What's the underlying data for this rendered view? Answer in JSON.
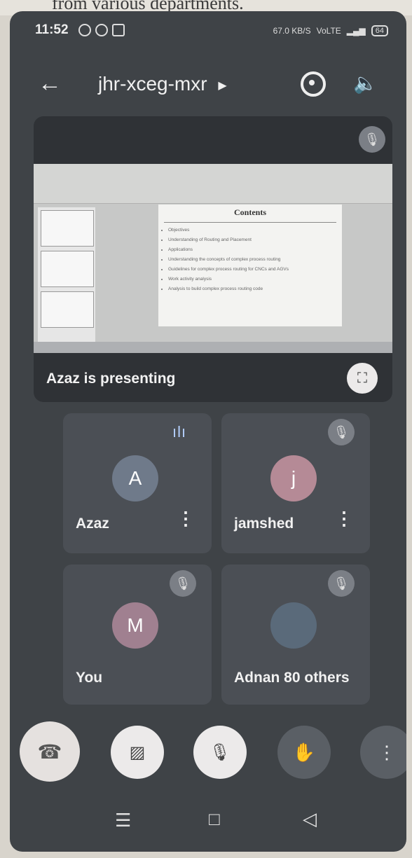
{
  "background_text": "from various departments.",
  "status_bar": {
    "time": "11:52",
    "speed": "67.0 KB/S",
    "network": "VoLTE",
    "battery": "64"
  },
  "header": {
    "meeting_code": "jhr-xceg-mxr",
    "back_icon": "arrow-left-icon",
    "switch_camera_icon": "switch-camera-icon",
    "speaker_icon": "speaker-icon"
  },
  "presentation": {
    "label": "Azaz is presenting",
    "slide_title": "Contents",
    "slide_bullets": [
      "Objectives",
      "Understanding of Routing and Placement",
      "Applications",
      "Understanding the concepts of complex process routing",
      "Guidelines for complex process routing for CNCs and AGVs",
      "Work activity analysis",
      "Analysis to build complex process routing code"
    ]
  },
  "participants": [
    {
      "name": "Azaz",
      "initial": "A",
      "color": "#6f7a8a",
      "muted": false,
      "speaking": true
    },
    {
      "name": "jamshed",
      "initial": "j",
      "color": "#b58a96",
      "muted": true,
      "speaking": false
    },
    {
      "name": "You",
      "initial": "M",
      "color": "#a08090",
      "muted": true,
      "speaking": false
    },
    {
      "name": "Adnan",
      "initial": "",
      "color": "#5a6a7a",
      "muted": true,
      "speaking": false
    }
  ],
  "others_label": "80 others",
  "controls": {
    "end_call_icon": "end-call-icon",
    "camera_icon": "camera-off-icon",
    "mic_icon": "mic-off-icon",
    "hand_icon": "raise-hand-icon",
    "more_icon": "more-icon"
  },
  "colors": {
    "end_call": "#e5e1df",
    "surface": "#3f4347",
    "tile": "#4b4f55"
  }
}
